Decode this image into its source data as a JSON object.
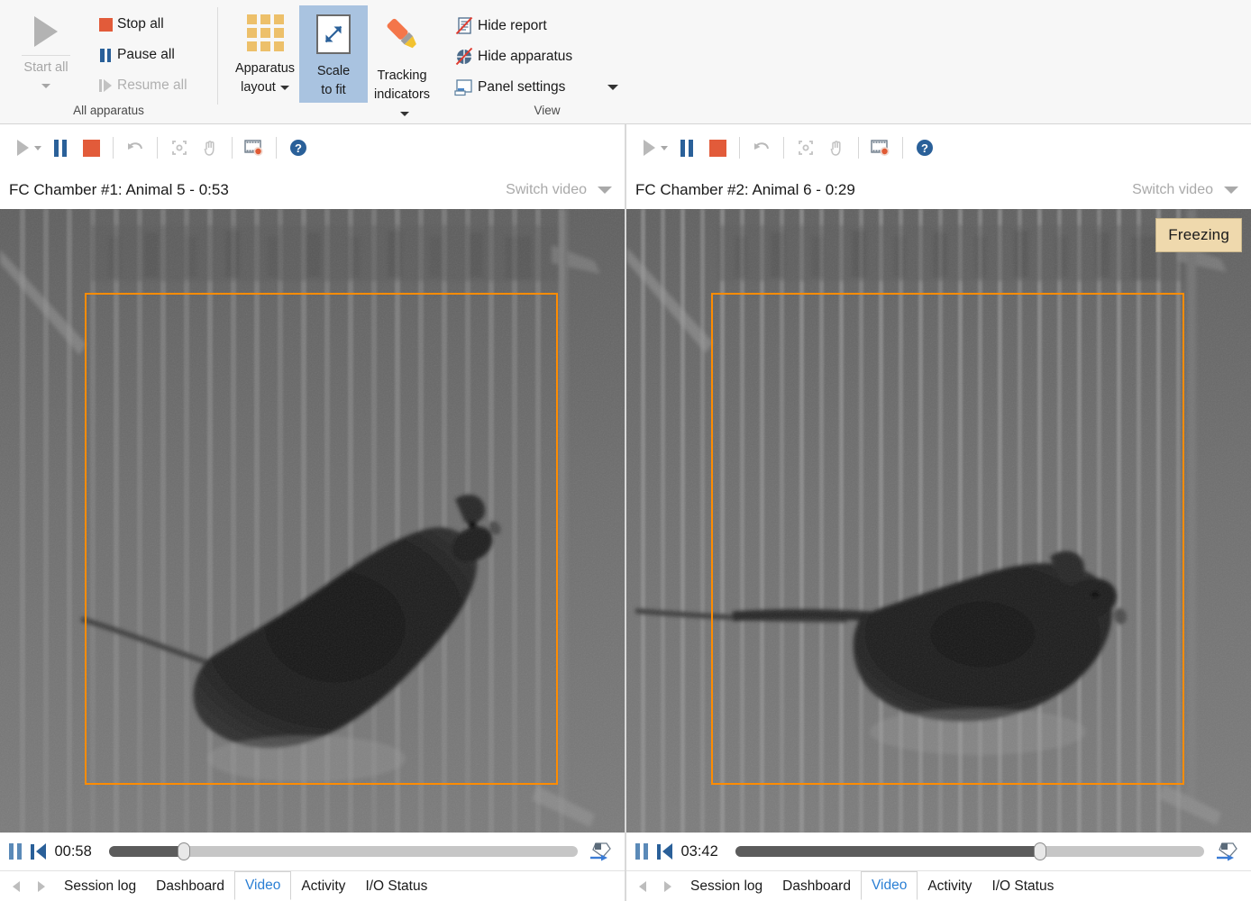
{
  "ribbon": {
    "groups": [
      {
        "label": "All apparatus",
        "start_all": {
          "label": "Start all",
          "icon": "play-icon",
          "enabled": false
        },
        "commands": [
          {
            "label": "Stop all",
            "icon": "stop-icon",
            "enabled": true
          },
          {
            "label": "Pause all",
            "icon": "pause-icon",
            "enabled": true
          },
          {
            "label": "Resume all",
            "icon": "resume-icon",
            "enabled": false
          }
        ]
      },
      {
        "label": "View",
        "big_buttons": [
          {
            "label_line1": "Apparatus",
            "label_line2": "layout",
            "icon": "grid-icon",
            "has_caret": true,
            "selected": false
          },
          {
            "label_line1": "Scale",
            "label_line2": "to fit",
            "icon": "scale-to-fit-icon",
            "has_caret": false,
            "selected": true
          },
          {
            "label_line1": "Tracking",
            "label_line2": "indicators",
            "icon": "marker-icon",
            "has_caret": true,
            "selected": false
          }
        ],
        "small_buttons": [
          {
            "label": "Hide report",
            "icon": "hide-report-icon",
            "has_caret": false
          },
          {
            "label": "Hide apparatus",
            "icon": "hide-apparatus-icon",
            "has_caret": false
          },
          {
            "label": "Panel settings",
            "icon": "panel-settings-icon",
            "has_caret": true
          }
        ]
      }
    ]
  },
  "panels": [
    {
      "toolbar": [
        {
          "icon": "play-icon",
          "enabled": false,
          "has_caret": true
        },
        {
          "icon": "pause-icon",
          "enabled": true
        },
        {
          "icon": "stop-icon",
          "enabled": true
        },
        {
          "icon": "undo-icon",
          "enabled": false
        },
        {
          "icon": "calibrate-icon",
          "enabled": false
        },
        {
          "icon": "hand-icon",
          "enabled": false
        },
        {
          "icon": "record-video-icon",
          "enabled": true
        },
        {
          "icon": "help-icon",
          "enabled": true
        }
      ],
      "title": "FC Chamber #1: Animal 5 - 0:53",
      "switch_video": {
        "label": "Switch video",
        "icon": "chevron-down-icon"
      },
      "video": {
        "tracking_rect": {
          "left_pct": 13.6,
          "top_pct": 13.4,
          "width_pct": 75.7,
          "height_pct": 79.0,
          "color": "#ff8c00"
        },
        "status_badge": null
      },
      "scrubber": {
        "pause_icon": "pause-icon",
        "prev_icon": "skip-previous-icon",
        "time": "00:58",
        "progress_pct": 16,
        "tag_icon": "tag-arrow-icon"
      },
      "tabs": [
        {
          "label": "Session log",
          "active": false
        },
        {
          "label": "Dashboard",
          "active": false
        },
        {
          "label": "Video",
          "active": true
        },
        {
          "label": "Activity",
          "active": false
        },
        {
          "label": "I/O Status",
          "active": false
        }
      ]
    },
    {
      "toolbar": [
        {
          "icon": "play-icon",
          "enabled": false,
          "has_caret": true
        },
        {
          "icon": "pause-icon",
          "enabled": true
        },
        {
          "icon": "stop-icon",
          "enabled": true
        },
        {
          "icon": "undo-icon",
          "enabled": false
        },
        {
          "icon": "calibrate-icon",
          "enabled": false
        },
        {
          "icon": "hand-icon",
          "enabled": false
        },
        {
          "icon": "record-video-icon",
          "enabled": true
        },
        {
          "icon": "help-icon",
          "enabled": true
        }
      ],
      "title": "FC Chamber #2: Animal 6 - 0:29",
      "switch_video": {
        "label": "Switch video",
        "icon": "chevron-down-icon"
      },
      "video": {
        "tracking_rect": {
          "left_pct": 13.6,
          "top_pct": 13.4,
          "width_pct": 75.7,
          "height_pct": 79.0,
          "color": "#ff8c00"
        },
        "status_badge": {
          "label": "Freezing",
          "bg": "#efd9ad"
        }
      },
      "scrubber": {
        "pause_icon": "pause-icon",
        "prev_icon": "skip-previous-icon",
        "time": "03:42",
        "progress_pct": 65,
        "tag_icon": "tag-arrow-icon"
      },
      "tabs": [
        {
          "label": "Session log",
          "active": false
        },
        {
          "label": "Dashboard",
          "active": false
        },
        {
          "label": "Video",
          "active": true
        },
        {
          "label": "Activity",
          "active": false
        },
        {
          "label": "I/O Status",
          "active": false
        }
      ]
    }
  ],
  "colors": {
    "accent_blue": "#2a6099",
    "stop_red": "#e25b3a",
    "selection_blue": "#a9c3e0",
    "tracking_orange": "#ff8c00",
    "badge_tan": "#efd9ad"
  }
}
